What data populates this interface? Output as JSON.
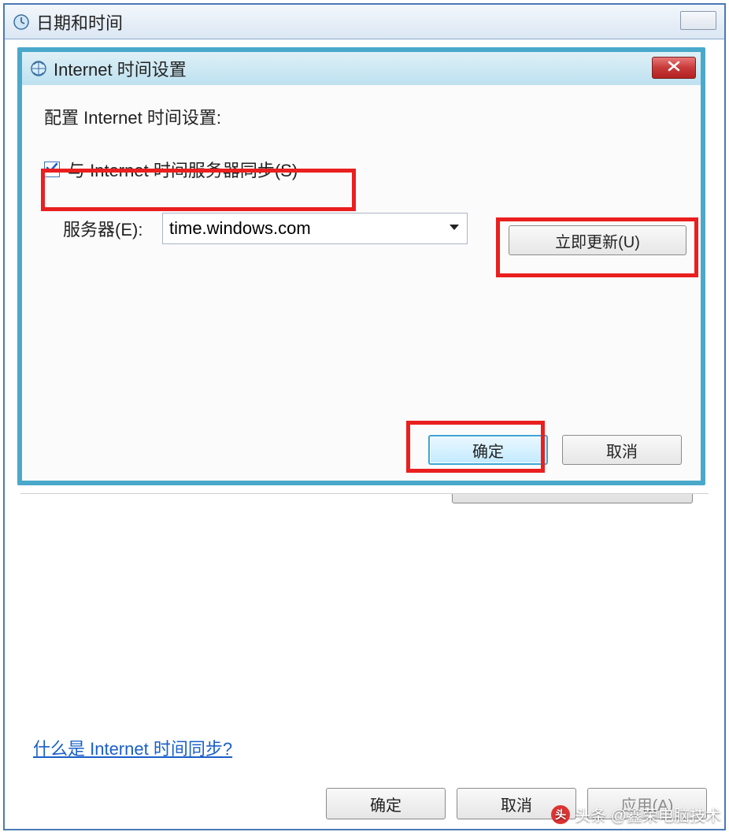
{
  "parent": {
    "title": "日期和时间",
    "help_link": "什么是 Internet 时间同步?",
    "ok": "确定",
    "cancel": "取消",
    "apply": "应用(A)"
  },
  "dialog": {
    "title": "Internet 时间设置",
    "config_label": "配置 Internet 时间设置:",
    "sync_checkbox_label": "与 Internet 时间服务器同步(S)",
    "sync_checked": true,
    "server_label": "服务器(E):",
    "server_value": "time.windows.com",
    "update_now": "立即更新(U)",
    "ok": "确定",
    "cancel": "取消"
  },
  "watermark": {
    "text": "头条 @鑫荣电脑技术"
  }
}
